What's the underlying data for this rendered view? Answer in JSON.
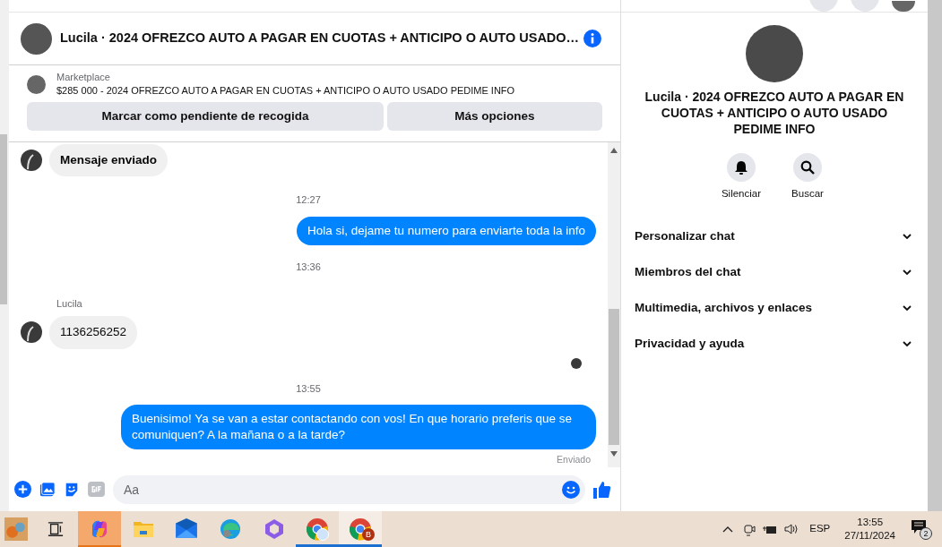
{
  "header": {
    "title": "Lucila · 2024 OFREZCO AUTO A PAGAR EN CUOTAS + ANTICIPO O AUTO USADO…"
  },
  "marketplace": {
    "label": "Marketplace",
    "listing": "$285 000 - 2024 OFREZCO AUTO A PAGAR EN CUOTAS + ANTICIPO O AUTO USADO PEDIME INFO",
    "buttons": [
      "Marcar como pendiente de recogida",
      "Más opciones"
    ]
  },
  "messages": [
    {
      "kind": "incoming",
      "text": "Mensaje enviado",
      "bold": true
    },
    {
      "kind": "timestamp",
      "text": "12:27"
    },
    {
      "kind": "outgoing",
      "text": "Hola si, dejame tu numero para enviarte toda la info"
    },
    {
      "kind": "timestamp",
      "text": "13:36"
    },
    {
      "kind": "sender",
      "text": "Lucila"
    },
    {
      "kind": "incoming",
      "text": "1136256252",
      "bold": false
    },
    {
      "kind": "read_receipt"
    },
    {
      "kind": "timestamp",
      "text": "13:55"
    },
    {
      "kind": "outgoing",
      "text": "Buenisimo! Ya se van a estar contactando con vos! En que horario preferis que se comuniquen? A la mañana o a la tarde?"
    },
    {
      "kind": "status",
      "text": "Enviado"
    }
  ],
  "composer": {
    "placeholder": "Aa"
  },
  "details": {
    "title": "Lucila · 2024 OFREZCO AUTO A PAGAR EN CUOTAS + ANTICIPO O AUTO USADO PEDIME INFO",
    "actions": [
      {
        "kind": "bell",
        "label": "Silenciar"
      },
      {
        "kind": "search",
        "label": "Buscar"
      }
    ],
    "sections": [
      {
        "label": "Personalizar chat",
        "expanded": false
      },
      {
        "label": "Miembros del chat",
        "expanded": false
      },
      {
        "label": "Multimedia, archivos y enlaces",
        "expanded": false
      },
      {
        "label": "Privacidad y ayuda",
        "expanded": false
      }
    ]
  },
  "taskbar": {
    "apps": [
      {
        "kind": "photo",
        "highlighted": false,
        "running": false
      },
      {
        "kind": "taskview",
        "highlighted": false,
        "running": false
      },
      {
        "kind": "copilot",
        "highlighted": true,
        "running": false
      },
      {
        "kind": "folder",
        "highlighted": false,
        "running": false
      },
      {
        "kind": "mail",
        "highlighted": false,
        "running": false
      },
      {
        "kind": "edge",
        "highlighted": false,
        "running": false
      },
      {
        "kind": "m365",
        "highlighted": false,
        "running": false
      },
      {
        "kind": "chrome",
        "highlighted": false,
        "running": true
      },
      {
        "kind": "chrome",
        "highlighted": false,
        "running": true,
        "badge": "B"
      }
    ],
    "language": "ESP",
    "time": "13:55",
    "date": "27/11/2024",
    "notifications": "2"
  }
}
